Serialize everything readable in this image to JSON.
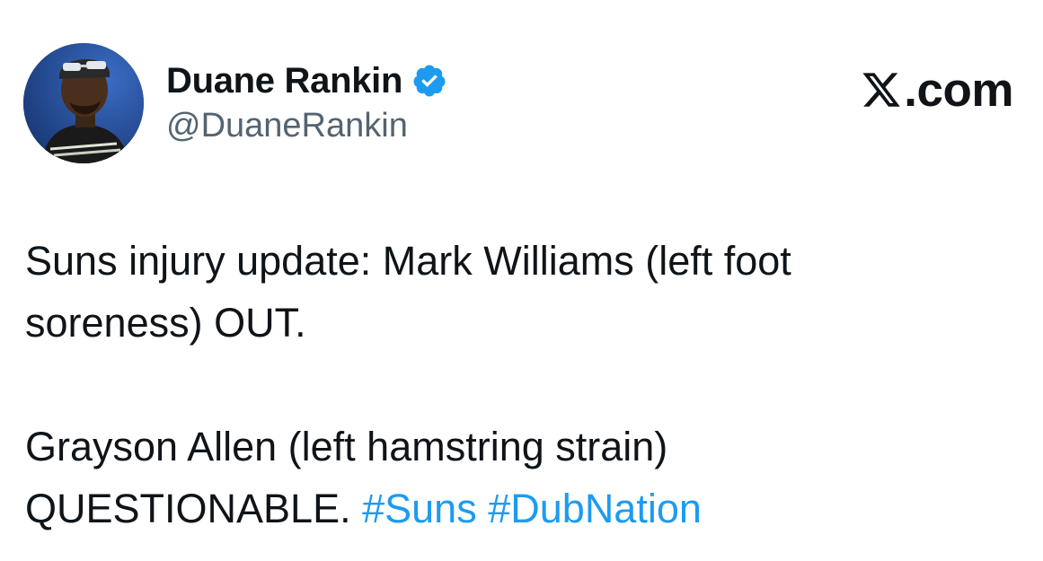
{
  "author": {
    "display_name": "Duane Rankin",
    "handle": "@DuaneRankin",
    "verified": true
  },
  "brand": {
    "label": ".com",
    "icon": "x-logo-icon"
  },
  "tweet": {
    "line1": "Suns injury update: Mark Williams (left foot",
    "line2": "soreness) OUT.",
    "line3": "Grayson Allen (left hamstring strain)",
    "line4_text": "QUESTIONABLE.",
    "hashtags": [
      "#Suns",
      "#DubNation"
    ]
  },
  "colors": {
    "hashtag": "#1d9bf0",
    "verified_badge": "#1d9bf0",
    "handle": "#536471",
    "text": "#0f1419"
  }
}
